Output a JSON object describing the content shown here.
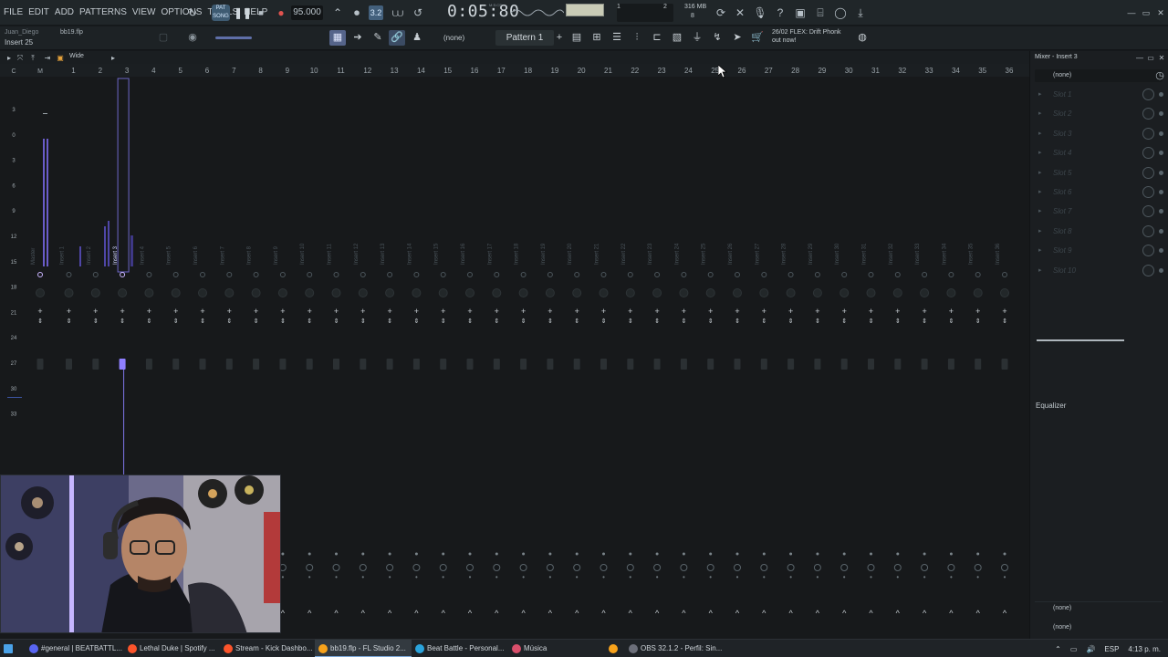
{
  "menu": [
    "FILE",
    "EDIT",
    "ADD",
    "PATTERNS",
    "VIEW",
    "OPTIONS",
    "TOOLS",
    "HELP"
  ],
  "transport": {
    "pat_song_label": "PAT SONG",
    "tempo": "95.000",
    "snap_label": "3.2",
    "time": "0:05:80",
    "time_unit": "M:S:CS",
    "poly_left": "1",
    "poly_right": "2",
    "poly_value": "8",
    "memory": "316 MB"
  },
  "row2": {
    "user": "Juan_Diego",
    "project": "bb19.flp",
    "hint": "Insert 25",
    "pattern_none": "(none)",
    "pattern": "Pattern 1",
    "news_line1": "26/02  FLEX: Drift Phonk",
    "news_line2": "out now!"
  },
  "mixer": {
    "view_mode": "Wide",
    "title": "Mixer - Insert 3",
    "route_none": "(none)",
    "equalizer_label": "Equalizer",
    "output_none_1": "(none)",
    "output_none_2": "(none)",
    "ruler_left": [
      "C",
      "M"
    ],
    "ruler_numbers": [
      "1",
      "2",
      "3",
      "4",
      "5",
      "6",
      "7",
      "8",
      "9",
      "10",
      "11",
      "12",
      "13",
      "14",
      "15",
      "16",
      "17",
      "18",
      "19",
      "20",
      "21",
      "22",
      "23",
      "24",
      "25",
      "26",
      "27",
      "28",
      "29",
      "30",
      "31",
      "32",
      "33",
      "34",
      "35",
      "36"
    ],
    "db_scale": [
      "3",
      "0",
      "3",
      "6",
      "9",
      "12",
      "15",
      "18",
      "21",
      "24",
      "27",
      "30",
      "33"
    ],
    "strips": [
      "Master",
      "Insert 1",
      "Insert 2",
      "Insert 3",
      "Insert 4",
      "Insert 5",
      "Insert 6",
      "Insert 7",
      "Insert 8",
      "Insert 9",
      "Insert 10",
      "Insert 11",
      "Insert 12",
      "Insert 13",
      "Insert 14",
      "Insert 15",
      "Insert 16",
      "Insert 17",
      "Insert 18",
      "Insert 19",
      "Insert 20",
      "Insert 21",
      "Insert 22",
      "Insert 23",
      "Insert 24",
      "Insert 25",
      "Insert 26",
      "Insert 27",
      "Insert 28",
      "Insert 29",
      "Insert 30",
      "Insert 31",
      "Insert 32",
      "Insert 33",
      "Insert 34",
      "Insert 35",
      "Insert 36"
    ],
    "slots": [
      "Slot 1",
      "Slot 2",
      "Slot 3",
      "Slot 4",
      "Slot 5",
      "Slot 6",
      "Slot 7",
      "Slot 8",
      "Slot 9",
      "Slot 10"
    ]
  },
  "taskbar": {
    "items": [
      {
        "label": "#general | BEATBATTL...",
        "icon": "discord-icon",
        "color": "#5865f2"
      },
      {
        "label": "Lethal Duke | Spotify ...",
        "icon": "brave-icon",
        "color": "#fb542b"
      },
      {
        "label": "Stream - Kick Dashbo...",
        "icon": "brave-icon",
        "color": "#fb542b"
      },
      {
        "label": "bb19.flp - FL Studio 2...",
        "icon": "fl-studio-icon",
        "color": "#f7a21b"
      },
      {
        "label": "Beat Battle - Personal...",
        "icon": "edge-icon",
        "color": "#2aa3dc"
      },
      {
        "label": "Música",
        "icon": "music-app-icon",
        "color": "#d94f6b"
      },
      {
        "label": "",
        "icon": "fl-studio-icon",
        "color": "#f7a21b"
      },
      {
        "label": "OBS 32.1.2 - Perfil: Sin...",
        "icon": "obs-icon",
        "color": "#6c6f7a"
      }
    ],
    "lang": "ESP",
    "clock": "4:13 p. m."
  },
  "colors": {
    "accent": "#7b6cf0",
    "meter": "#6a5cc9",
    "selected_strip": "#8f7fff"
  }
}
